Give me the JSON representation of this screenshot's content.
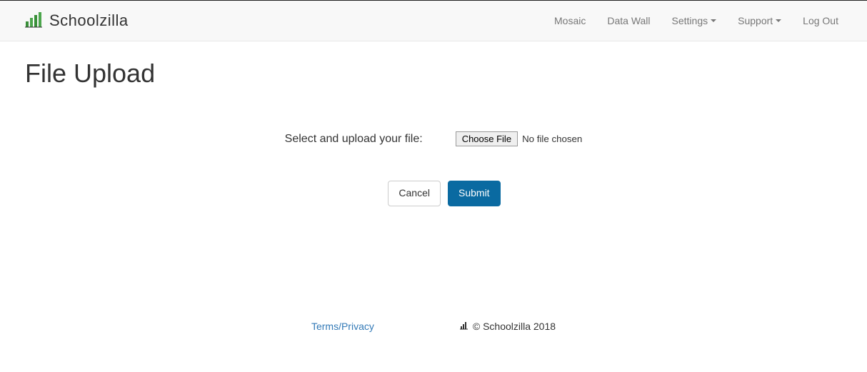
{
  "brand": {
    "name": "Schoolzilla"
  },
  "nav": {
    "mosaic": "Mosaic",
    "datawall": "Data Wall",
    "settings": "Settings",
    "support": "Support",
    "logout": "Log Out"
  },
  "page": {
    "title": "File Upload"
  },
  "form": {
    "label": "Select and upload your file:",
    "chooseFile": "Choose File",
    "noFile": "No file chosen",
    "cancel": "Cancel",
    "submit": "Submit"
  },
  "footer": {
    "terms": "Terms",
    "privacy": "Privacy",
    "separator": "/",
    "copyright": "© Schoolzilla 2018"
  }
}
